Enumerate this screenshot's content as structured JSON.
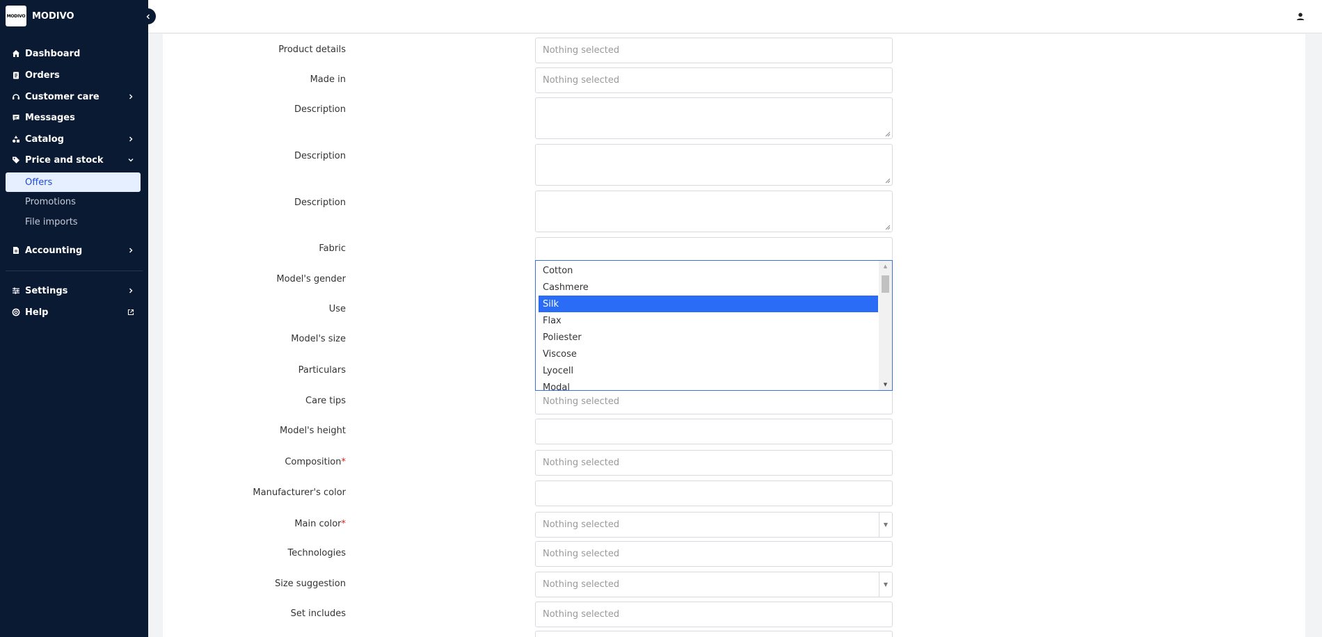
{
  "brand": {
    "logo_text": "MODIVO",
    "name": "MODIVO"
  },
  "sidebar": {
    "items": [
      {
        "label": "Dashboard",
        "icon": "home-icon"
      },
      {
        "label": "Orders",
        "icon": "clipboard-icon"
      },
      {
        "label": "Customer care",
        "icon": "headset-icon"
      },
      {
        "label": "Messages",
        "icon": "chat-icon"
      },
      {
        "label": "Catalog",
        "icon": "shapes-icon"
      },
      {
        "label": "Price and stock",
        "icon": "tag-icon"
      },
      {
        "label": "Accounting",
        "icon": "document-icon"
      },
      {
        "label": "Settings",
        "icon": "sliders-icon"
      },
      {
        "label": "Help",
        "icon": "lifebuoy-icon"
      }
    ],
    "price_and_stock_sub": [
      {
        "label": "Offers",
        "active": true
      },
      {
        "label": "Promotions",
        "active": false
      },
      {
        "label": "File imports",
        "active": false
      }
    ]
  },
  "form": {
    "fields": {
      "product_details": {
        "label": "Product details",
        "value": "Nothing selected"
      },
      "made_in": {
        "label": "Made in",
        "value": "Nothing selected"
      },
      "description_1": {
        "label": "Description"
      },
      "description_2": {
        "label": "Description"
      },
      "description_3": {
        "label": "Description"
      },
      "fabric": {
        "label": "Fabric"
      },
      "models_gender": {
        "label": "Model's gender"
      },
      "use": {
        "label": "Use"
      },
      "models_size": {
        "label": "Model's size"
      },
      "particulars": {
        "label": "Particulars"
      },
      "care_tips": {
        "label": "Care tips",
        "value": "Nothing selected"
      },
      "models_height": {
        "label": "Model's height",
        "value": ""
      },
      "composition": {
        "label": "Composition",
        "required_mark": "*",
        "value": "Nothing selected"
      },
      "manufacturers_color": {
        "label": "Manufacturer's color",
        "value": ""
      },
      "main_color": {
        "label": "Main color",
        "required_mark": "*",
        "value": "Nothing selected"
      },
      "technologies": {
        "label": "Technologies",
        "value": "Nothing selected"
      },
      "size_suggestion": {
        "label": "Size suggestion",
        "value": "Nothing selected"
      },
      "set_includes": {
        "label": "Set includes",
        "value": "Nothing selected"
      }
    },
    "fabric_options": [
      "Cotton",
      "Cashmere",
      "Silk",
      "Flax",
      "Poliester",
      "Viscose",
      "Lyocell",
      "Modal"
    ],
    "fabric_selected": "Silk"
  },
  "colors": {
    "sidebar_bg": "#0a1a33",
    "selected_option": "#2a6cf5",
    "active_sub_bg": "#e6efff",
    "required": "#d92121"
  }
}
